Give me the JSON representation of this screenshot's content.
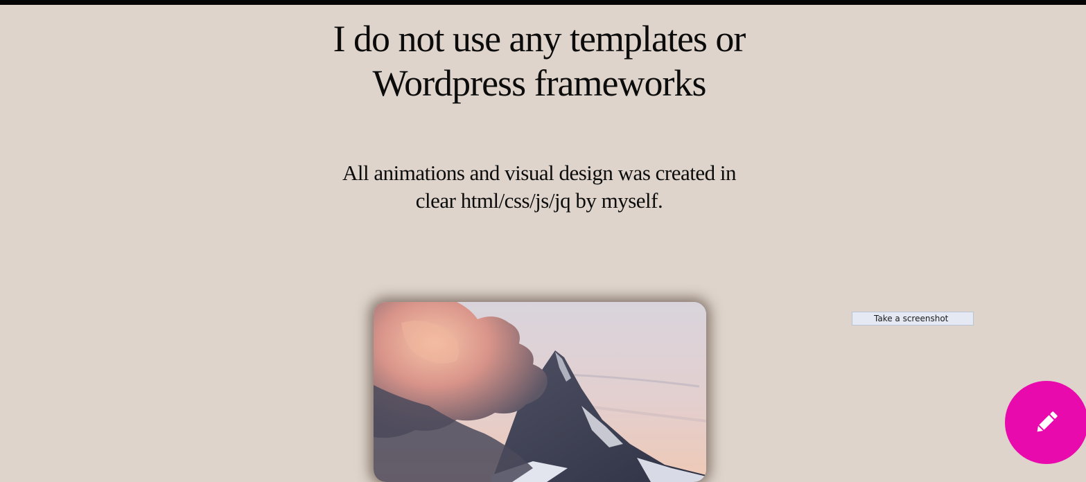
{
  "headline": {
    "line1": "I do not use any templates or",
    "line2": "Wordpress frameworks"
  },
  "subtitle": {
    "line1": "All animations and visual design was created in",
    "line2": "clear html/css/js/jq by myself."
  },
  "photo": {
    "icon": "mountain-photo"
  },
  "screenshot_button": {
    "label": "Take a screenshot"
  },
  "edit_button": {
    "icon": "pencil-icon",
    "color": "#e90aad"
  },
  "colors": {
    "background": "#ded4cb",
    "top_bar": "#050505"
  }
}
